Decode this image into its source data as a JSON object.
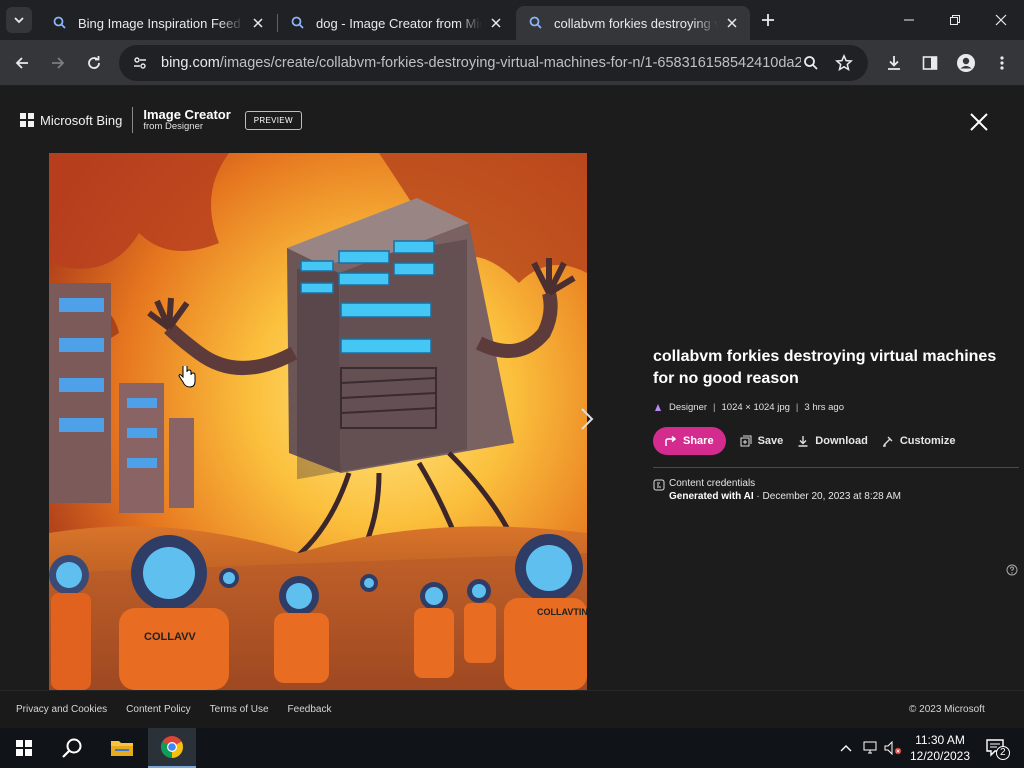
{
  "browser": {
    "tabs": [
      {
        "title": "Bing Image Inspiration Feed",
        "active": false
      },
      {
        "title": "dog - Image Creator from Microsoft",
        "active": false
      },
      {
        "title": "collabvm forkies destroying virtual machines for no good reason",
        "active": true
      }
    ],
    "url_host": "bing.com",
    "url_path": "/images/create/collabvm-forkies-destroying-virtual-machines-for-n/1-658316158542410da2..."
  },
  "header": {
    "brand": "Microsoft Bing",
    "product": "Image Creator",
    "product_sub": "from Designer",
    "badge": "PREVIEW"
  },
  "detail": {
    "title": "collabvm forkies destroying virtual machines for no good reason",
    "meta_app": "Designer",
    "meta_size": "1024 × 1024 jpg",
    "meta_age": "3 hrs ago",
    "share_label": "Share",
    "save_label": "Save",
    "download_label": "Download",
    "customize_label": "Customize",
    "cred_title": "Content credentials",
    "cred_generated": "Generated with AI",
    "cred_date": " · December 20, 2023 at 8:28 AM"
  },
  "footer": {
    "links": [
      "Privacy and Cookies",
      "Content Policy",
      "Terms of Use",
      "Feedback"
    ],
    "copyright": "© 2023 Microsoft"
  },
  "taskbar": {
    "time": "11:30 AM",
    "date": "12/20/2023",
    "notif_count": "2"
  },
  "colors": {
    "accent_pink": "#d42b8f",
    "page_bg": "#1c1c1c"
  }
}
